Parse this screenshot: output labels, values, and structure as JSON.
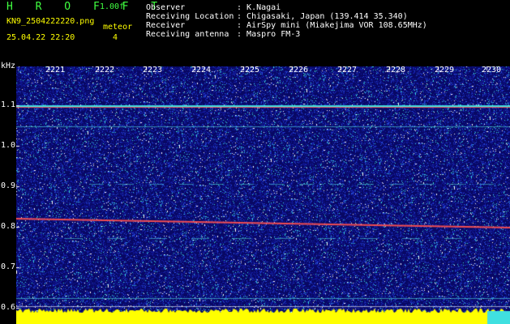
{
  "header": {
    "title": "H R O F F T",
    "version": "1.00f",
    "filename": "KN9_2504222220.png",
    "category": "meteor",
    "count": "4",
    "datetime": "25.04.22 22:20"
  },
  "info": [
    {
      "label": "Observer",
      "value": "K.Nagai"
    },
    {
      "label": "Receiving Location",
      "value": "Chigasaki, Japan (139.414 35.340)"
    },
    {
      "label": "Receiver",
      "value": "AirSpy mini (Miakejima VOR 108.65MHz)"
    },
    {
      "label": "Receiving antenna",
      "value": "Maspro FM-3"
    }
  ],
  "axis": {
    "y_unit": "kHz",
    "y_ticks": [
      "1.1",
      "1.0",
      "0.9",
      "0.8",
      "0.7",
      "0.6"
    ],
    "x_ticks": [
      "2221",
      "2222",
      "2223",
      "2224",
      "2225",
      "2226",
      "2227",
      "2228",
      "2229",
      "2230"
    ]
  },
  "colors": {
    "background": "#000000",
    "spectrum_bg": "#0a0a6e",
    "noise_floor": "#ffff00",
    "header_text": "#ffff00",
    "title_text": "#40ff40",
    "axis_text": "#ffffff",
    "carrier_line": "#ff3030"
  }
}
